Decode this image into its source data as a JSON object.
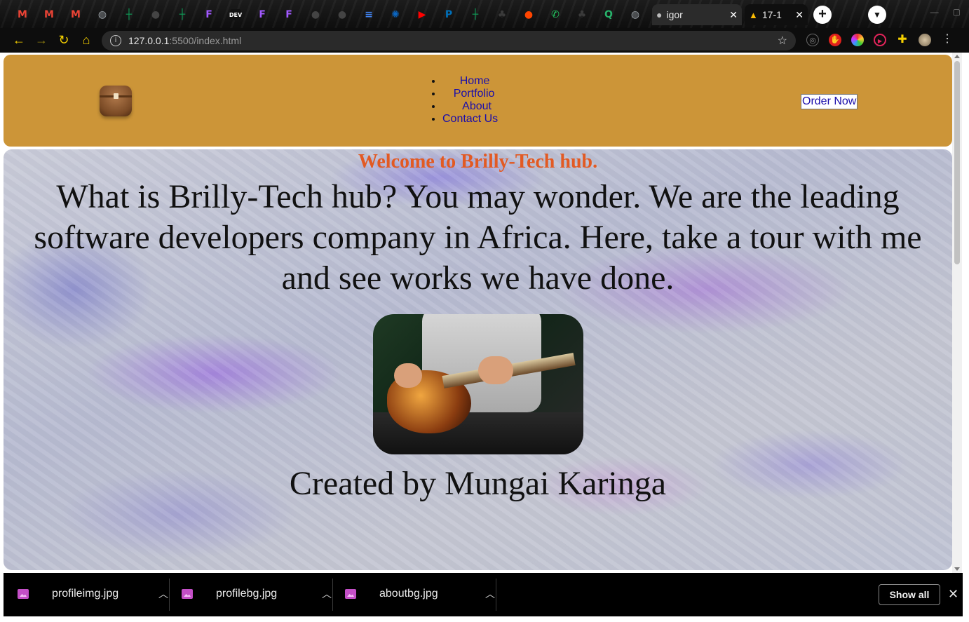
{
  "browser": {
    "pinned_tabs": [
      {
        "icon": "gmail-icon",
        "glyph": "M",
        "color": "#ea4335"
      },
      {
        "icon": "gmail-icon",
        "glyph": "M",
        "color": "#ea4335"
      },
      {
        "icon": "gmail-icon",
        "glyph": "M",
        "color": "#ea4335"
      },
      {
        "icon": "globe-icon",
        "glyph": "◍",
        "color": "#9aa0a6"
      },
      {
        "icon": "sheets-icon",
        "glyph": "┼",
        "color": "#0f9d58"
      },
      {
        "icon": "github-icon",
        "glyph": "●",
        "color": "#444444"
      },
      {
        "icon": "sheets-icon",
        "glyph": "┼",
        "color": "#0f9d58"
      },
      {
        "icon": "figma-icon",
        "glyph": "F",
        "color": "#a259ff"
      },
      {
        "icon": "dev-icon",
        "glyph": "DEV",
        "color": "#111111"
      },
      {
        "icon": "figma-icon",
        "glyph": "F",
        "color": "#a259ff"
      },
      {
        "icon": "figma-icon",
        "glyph": "F",
        "color": "#a259ff"
      },
      {
        "icon": "github-icon",
        "glyph": "●",
        "color": "#444444"
      },
      {
        "icon": "github-icon",
        "glyph": "●",
        "color": "#444444"
      },
      {
        "icon": "docs-icon",
        "glyph": "≡",
        "color": "#4285f4"
      },
      {
        "icon": "web-icon",
        "glyph": "✺",
        "color": "#0a66c2"
      },
      {
        "icon": "youtube-icon",
        "glyph": "▶",
        "color": "#ff0000"
      },
      {
        "icon": "paypal-icon",
        "glyph": "P",
        "color": "#0070ba"
      },
      {
        "icon": "sheets-icon",
        "glyph": "┼",
        "color": "#0f9d58"
      },
      {
        "icon": "tree-icon",
        "glyph": "♣",
        "color": "#3a3a3a"
      },
      {
        "icon": "reddit-icon",
        "glyph": "●",
        "color": "#ff4500"
      },
      {
        "icon": "whatsapp-icon",
        "glyph": "✆",
        "color": "#25d366"
      },
      {
        "icon": "tree-icon",
        "glyph": "♣",
        "color": "#3a3a3a"
      },
      {
        "icon": "q-icon",
        "glyph": "Q",
        "color": "#27b36b"
      },
      {
        "icon": "globe-icon",
        "glyph": "◍",
        "color": "#9aa0a6"
      }
    ],
    "tabs": [
      {
        "title": "igor",
        "icon": "github-icon"
      },
      {
        "title": "17-1",
        "icon": "drive-icon"
      }
    ],
    "url_host": "127.0.0.1",
    "url_path": ":5500/index.html"
  },
  "site": {
    "nav": [
      "Home",
      "Portfolio",
      "About",
      "Contact Us"
    ],
    "order_button": "Order Now",
    "welcome": "Welcome to Brilly-Tech hub.",
    "intro": "What is Brilly-Tech hub? You may wonder. We are the leading software developers company in Africa. Here, take a tour with me and see works we have done.",
    "credit": "Created by Mungai Karinga"
  },
  "downloads": {
    "items": [
      "profileimg.jpg",
      "profilebg.jpg",
      "aboutbg.jpg"
    ],
    "show_all": "Show all"
  },
  "colors": {
    "header_bg": "#cc9538",
    "welcome_text": "#e25a23",
    "link": "#1a0dab"
  }
}
